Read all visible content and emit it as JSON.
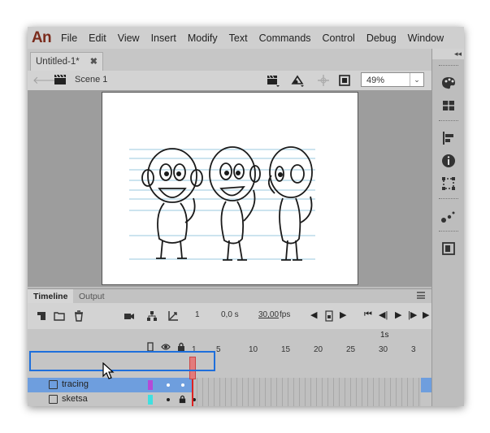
{
  "app": {
    "logo": "An"
  },
  "menu": [
    "File",
    "Edit",
    "View",
    "Insert",
    "Modify",
    "Text",
    "Commands",
    "Control",
    "Debug",
    "Window"
  ],
  "document_tab": {
    "title": "Untitled-1*",
    "close_glyph": "✖"
  },
  "edit_bar": {
    "scene_label": "Scene 1",
    "zoom_value": "49%",
    "zoom_arrow": "⌄"
  },
  "timeline": {
    "tabs": [
      "Timeline",
      "Output"
    ],
    "current_frame": "1",
    "time": "0,0 s",
    "fps_value": "30,00",
    "fps_unit": "fps",
    "ruler_seconds_label": "1s",
    "ruler_ticks": [
      "1",
      "5",
      "10",
      "15",
      "20",
      "25",
      "30",
      "3"
    ],
    "layers": [
      {
        "name": "tracing",
        "color": "#b44ad7",
        "selected": true
      },
      {
        "name": "sketsa",
        "color": "#3fe0e0",
        "selected": false,
        "locked": true
      }
    ]
  },
  "colors": {
    "selection": "#6e9ede",
    "highlight_border": "#1e6fdc",
    "playhead": "#dd2222"
  }
}
